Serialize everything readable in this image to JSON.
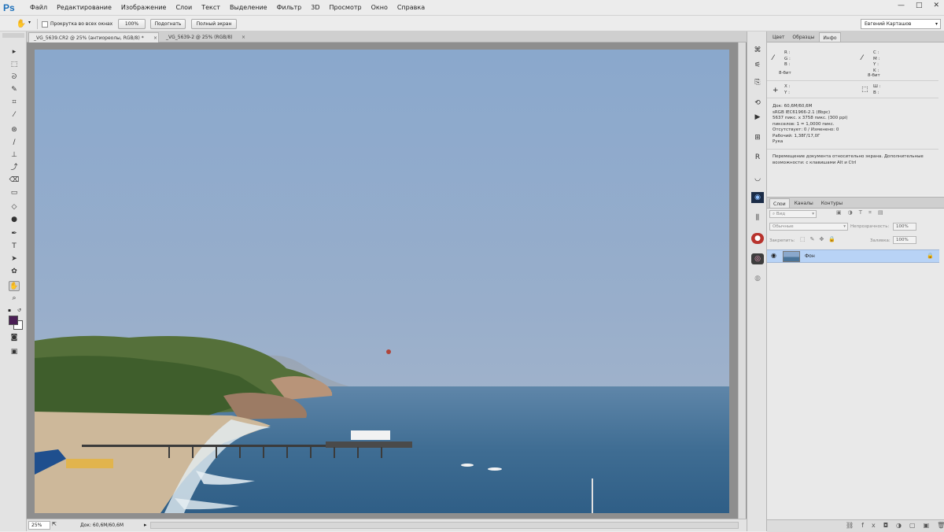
{
  "app": {
    "logo": "Ps"
  },
  "menu": [
    "Файл",
    "Редактирование",
    "Изображение",
    "Слои",
    "Текст",
    "Выделение",
    "Фильтр",
    "3D",
    "Просмотр",
    "Окно",
    "Справка"
  ],
  "window_controls": {
    "minimize": "—",
    "maximize": "□",
    "close": "✕"
  },
  "options_bar": {
    "scroll_all_label": "Прокрутка во всех окнах",
    "zoom_100_label": "100%",
    "fit_label": "Подогнать",
    "fullscreen_label": "Полный экран",
    "workspace_value": "Евгений Карташов"
  },
  "doc_tabs": [
    {
      "label": "_VG_5639.CR2 @ 25% (антиореолы, RGB/8) *",
      "close": "×"
    },
    {
      "label": "_VG_5639-2 @ 25% (RGB/8)",
      "close": "×"
    }
  ],
  "status_bar": {
    "zoom": "25%",
    "doc_size": "Док: 60,6M/60,6M"
  },
  "info_panel": {
    "tabs": [
      "Цвет",
      "Образцы",
      "Инфо"
    ],
    "active_tab": "Инфо",
    "rgb_labels": [
      "R :",
      "G :",
      "B :"
    ],
    "cmyk_labels": [
      "C :",
      "M :",
      "Y :",
      "K :"
    ],
    "bit_left": "8-бит",
    "bit_right": "8-бит",
    "xy_labels": [
      "X :",
      "Y :"
    ],
    "wh_labels": [
      "Ш :",
      "В :"
    ],
    "details": [
      "Док: 60,6M/60,6M",
      "sRGB IEC61966-2.1 (8bpc)",
      "5637 пикс. x 3758 пикс. (300 ppi)",
      "пикселов: 1 = 1,0000 пикс.",
      "Отсутствует: 0 / Изменено: 0",
      "Рабочий: 1,38Г/17,0Г",
      "Рука"
    ],
    "hint": [
      "Перемещение документа относительно экрана. Дополнительные",
      "возможности: с клавишами Alt и Ctrl"
    ]
  },
  "layers_panel": {
    "tabs": [
      "Слои",
      "Каналы",
      "Контуры"
    ],
    "active_tab": "Слои",
    "kind_filter": "Вид",
    "blend_mode": "Обычные",
    "opacity_label": "Непрозрачность:",
    "opacity_value": "100%",
    "lock_label": "Закрепить:",
    "fill_label": "Заливка:",
    "fill_value": "100%",
    "layers": [
      {
        "name": "Фон",
        "visible": true,
        "locked": true
      }
    ]
  },
  "colors": {
    "ui_bg": "#ececec",
    "doc_bg": "#8e8e8e",
    "layer_selected": "#b8d3f6",
    "foreground_swatch": "#4a1e55",
    "background_swatch": "#ffffff",
    "ps_blue": "#1c6fb9"
  }
}
